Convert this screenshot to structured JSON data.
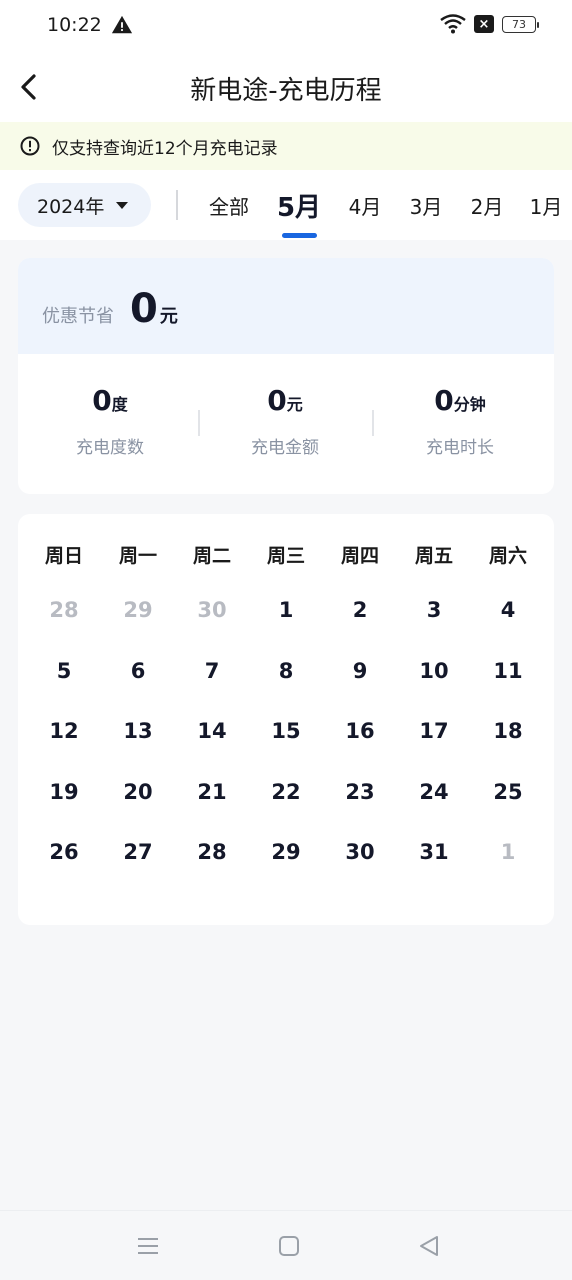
{
  "status_bar": {
    "time": "10:22",
    "battery": "73"
  },
  "nav": {
    "title": "新电途-充电历程"
  },
  "notice": {
    "text": "仅支持查询近12个月充电记录"
  },
  "filter": {
    "year_label": "2024年",
    "tabs": [
      "全部",
      "5月",
      "4月",
      "3月",
      "2月",
      "1月"
    ],
    "active_tab": "5月"
  },
  "summary": {
    "saving_label": "优惠节省",
    "saving_value": "0",
    "saving_unit": "元",
    "stats": [
      {
        "value": "0",
        "unit": "度",
        "label": "充电度数"
      },
      {
        "value": "0",
        "unit": "元",
        "label": "充电金额"
      },
      {
        "value": "0",
        "unit": "分钟",
        "label": "充电时长"
      }
    ]
  },
  "calendar": {
    "weekdays": [
      "周日",
      "周一",
      "周二",
      "周三",
      "周四",
      "周五",
      "周六"
    ],
    "days": [
      {
        "d": "28",
        "muted": true
      },
      {
        "d": "29",
        "muted": true
      },
      {
        "d": "30",
        "muted": true
      },
      {
        "d": "1"
      },
      {
        "d": "2"
      },
      {
        "d": "3"
      },
      {
        "d": "4"
      },
      {
        "d": "5"
      },
      {
        "d": "6"
      },
      {
        "d": "7"
      },
      {
        "d": "8"
      },
      {
        "d": "9"
      },
      {
        "d": "10"
      },
      {
        "d": "11"
      },
      {
        "d": "12"
      },
      {
        "d": "13"
      },
      {
        "d": "14"
      },
      {
        "d": "15"
      },
      {
        "d": "16"
      },
      {
        "d": "17"
      },
      {
        "d": "18"
      },
      {
        "d": "19"
      },
      {
        "d": "20"
      },
      {
        "d": "21"
      },
      {
        "d": "22"
      },
      {
        "d": "23"
      },
      {
        "d": "24"
      },
      {
        "d": "25"
      },
      {
        "d": "26"
      },
      {
        "d": "27"
      },
      {
        "d": "28"
      },
      {
        "d": "29"
      },
      {
        "d": "30"
      },
      {
        "d": "31"
      },
      {
        "d": "1",
        "muted": true
      }
    ]
  },
  "icons": {
    "warning": "warning-icon",
    "wifi": "wifi-icon",
    "box_x": "sim-x-icon",
    "back": "back-arrow-icon",
    "info": "info-circle-icon",
    "caret": "caret-down-icon",
    "menu": "menu-icon",
    "home": "home-square-icon",
    "back_triangle": "back-triangle-icon"
  },
  "colors": {
    "accent": "#1966e0",
    "notice_bg": "#f8fbe9",
    "summary_bg": "#eef4fd"
  }
}
